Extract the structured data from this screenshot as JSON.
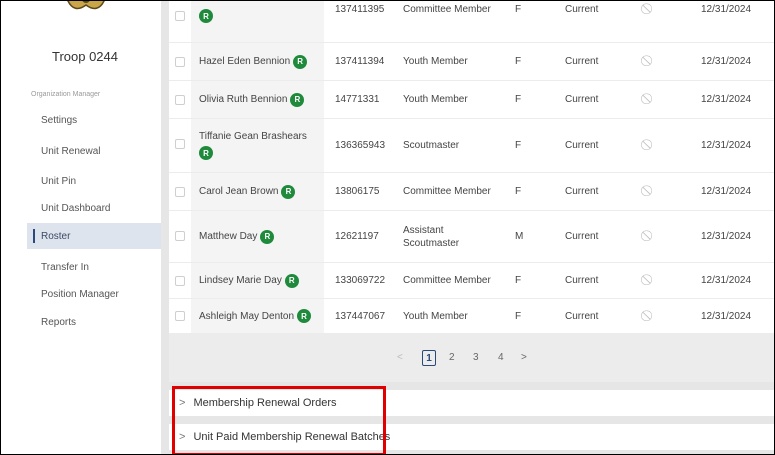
{
  "sidebar": {
    "troop_name": "Troop 0244",
    "section_label": "Organization Manager",
    "items": [
      {
        "label": "Settings",
        "active": false
      },
      {
        "label": "Unit Renewal",
        "active": false
      },
      {
        "label": "Unit Pin",
        "active": false
      },
      {
        "label": "Unit Dashboard",
        "active": false
      },
      {
        "label": "Roster",
        "active": true
      },
      {
        "label": "Transfer In",
        "active": false
      },
      {
        "label": "Position Manager",
        "active": false
      },
      {
        "label": "Reports",
        "active": false
      }
    ]
  },
  "roster": {
    "rows": [
      {
        "name": "",
        "id": "137411395",
        "position": "Committee Member",
        "gender": "F",
        "status": "Current",
        "expires": "12/31/2024",
        "badge": "R"
      },
      {
        "name": "Hazel Eden Bennion",
        "id": "137411394",
        "position": "Youth Member",
        "gender": "F",
        "status": "Current",
        "expires": "12/31/2024",
        "badge": "R"
      },
      {
        "name": "Olivia Ruth Bennion",
        "id": "14771331",
        "position": "Youth Member",
        "gender": "F",
        "status": "Current",
        "expires": "12/31/2024",
        "badge": "R"
      },
      {
        "name": "Tiffanie Gean Brashears",
        "id": "136365943",
        "position": "Scoutmaster",
        "gender": "F",
        "status": "Current",
        "expires": "12/31/2024",
        "badge": "R"
      },
      {
        "name": "Carol Jean Brown",
        "id": "13806175",
        "position": "Committee Member",
        "gender": "F",
        "status": "Current",
        "expires": "12/31/2024",
        "badge": "R"
      },
      {
        "name": "Matthew Day",
        "id": "12621197",
        "position": "Assistant Scoutmaster",
        "gender": "M",
        "status": "Current",
        "expires": "12/31/2024",
        "badge": "R"
      },
      {
        "name": "Lindsey Marie Day",
        "id": "133069722",
        "position": "Committee Member",
        "gender": "F",
        "status": "Current",
        "expires": "12/31/2024",
        "badge": "R"
      },
      {
        "name": "Ashleigh May Denton",
        "id": "137447067",
        "position": "Youth Member",
        "gender": "F",
        "status": "Current",
        "expires": "12/31/2024",
        "badge": "R"
      }
    ]
  },
  "pagination": {
    "prev": "<",
    "next": ">",
    "pages": [
      "1",
      "2",
      "3",
      "4"
    ],
    "current": "1"
  },
  "panels": {
    "orders": {
      "chevron": ">",
      "label": "Membership Renewal Orders"
    },
    "batches": {
      "chevron": ">",
      "label": "Unit Paid Membership Renewal Batches"
    }
  },
  "colors": {
    "badge": "#1f8a3c",
    "highlight": "#e00000",
    "active_nav": "#dde4ee"
  },
  "icons": {
    "status_icon": "ban-icon",
    "expand_icon": "chevron-right-icon"
  }
}
